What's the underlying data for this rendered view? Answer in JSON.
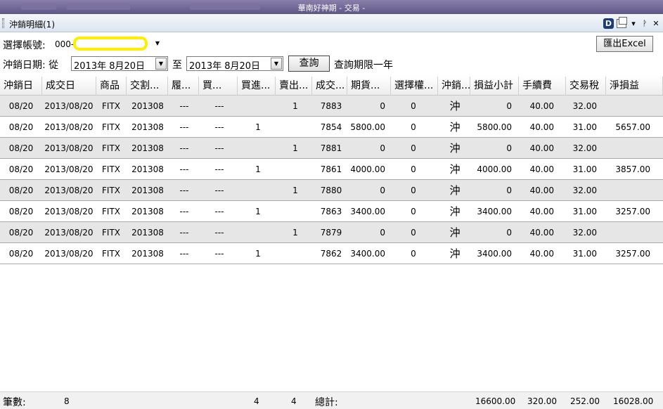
{
  "window": {
    "title": "華南好神期 - 交易 -"
  },
  "panel": {
    "title": "沖銷明細(1)",
    "dock_label": "D"
  },
  "account": {
    "label": "選擇帳號:",
    "prefix": "000-"
  },
  "export_button": "匯出Excel",
  "date_range": {
    "label": "沖銷日期: 從",
    "from": "2013年  8月20日",
    "to_label": "至",
    "to": "2013年  8月20日",
    "query_button": "查詢",
    "note": "查詢期限一年"
  },
  "table": {
    "columns": [
      "沖銷日",
      "成交日",
      "商品",
      "交割...",
      "履...",
      "買...",
      "買進...",
      "賣出...",
      "成交...",
      "期貨...",
      "選擇權...",
      "沖銷...",
      "損益小計",
      "手續費",
      "交易稅",
      "淨損益"
    ],
    "rows": [
      [
        "08/20",
        "2013/08/20",
        "FITX",
        "201308",
        "---",
        "---",
        "",
        "1",
        "7883",
        "0",
        "0",
        "沖",
        "0",
        "40.00",
        "32.00",
        ""
      ],
      [
        "08/20",
        "2013/08/20",
        "FITX",
        "201308",
        "---",
        "---",
        "1",
        "",
        "7854",
        "5800.00",
        "0",
        "沖",
        "5800.00",
        "40.00",
        "31.00",
        "5657.00"
      ],
      [
        "08/20",
        "2013/08/20",
        "FITX",
        "201308",
        "---",
        "---",
        "",
        "1",
        "7881",
        "0",
        "0",
        "沖",
        "0",
        "40.00",
        "32.00",
        ""
      ],
      [
        "08/20",
        "2013/08/20",
        "FITX",
        "201308",
        "---",
        "---",
        "1",
        "",
        "7861",
        "4000.00",
        "0",
        "沖",
        "4000.00",
        "40.00",
        "31.00",
        "3857.00"
      ],
      [
        "08/20",
        "2013/08/20",
        "FITX",
        "201308",
        "---",
        "---",
        "",
        "1",
        "7880",
        "0",
        "0",
        "沖",
        "0",
        "40.00",
        "32.00",
        ""
      ],
      [
        "08/20",
        "2013/08/20",
        "FITX",
        "201308",
        "---",
        "---",
        "1",
        "",
        "7863",
        "3400.00",
        "0",
        "沖",
        "3400.00",
        "40.00",
        "31.00",
        "3257.00"
      ],
      [
        "08/20",
        "2013/08/20",
        "FITX",
        "201308",
        "---",
        "---",
        "",
        "1",
        "7879",
        "0",
        "0",
        "沖",
        "0",
        "40.00",
        "32.00",
        ""
      ],
      [
        "08/20",
        "2013/08/20",
        "FITX",
        "201308",
        "---",
        "---",
        "1",
        "",
        "7862",
        "3400.00",
        "0",
        "沖",
        "3400.00",
        "40.00",
        "31.00",
        "3257.00"
      ]
    ]
  },
  "footer": {
    "count_label": "筆數:",
    "count": "8",
    "buy_total": "4",
    "sell_total": "4",
    "total_label": "總計:",
    "pnl_total": "16600.00",
    "fee_total": "320.00",
    "tax_total": "252.00",
    "net_total": "16028.00"
  },
  "colors": {
    "highlight": "#ffee00",
    "row_alt": "#e6e6e6"
  }
}
